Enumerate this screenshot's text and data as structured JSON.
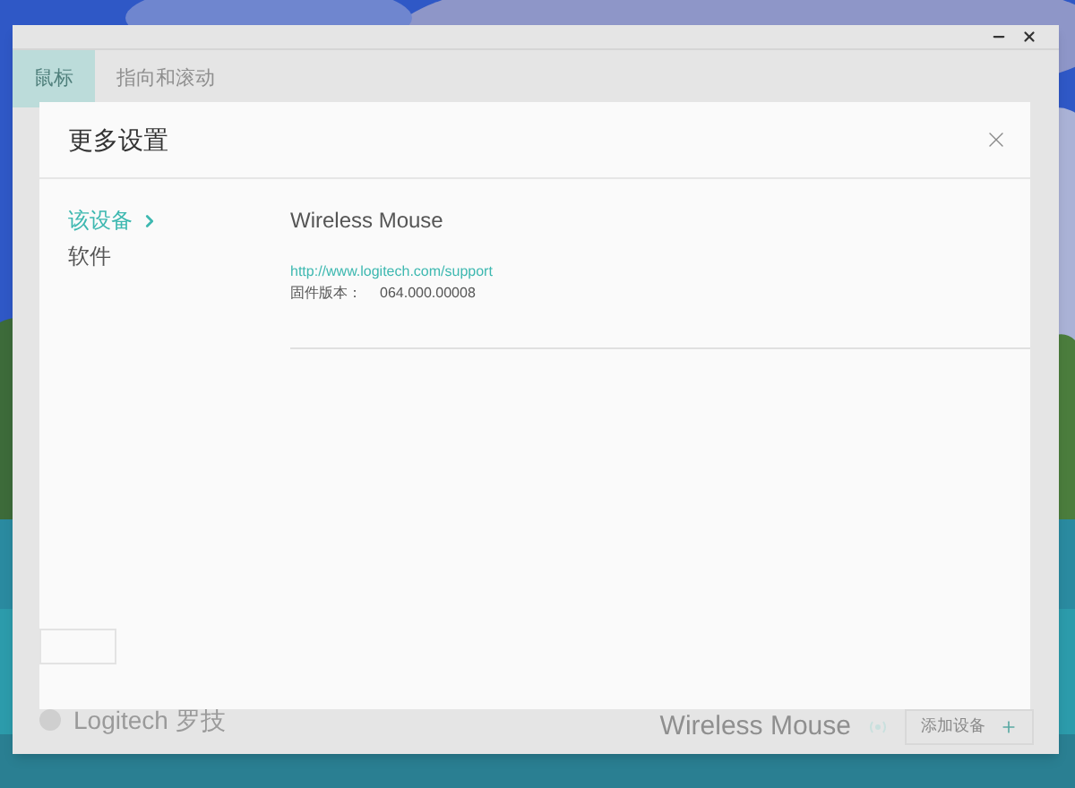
{
  "app": {
    "tabs": [
      {
        "label": "鼠标",
        "selected": true
      },
      {
        "label": "指向和滚动",
        "selected": false
      }
    ],
    "footer": {
      "brand": "Logitech 罗技",
      "device": "Wireless Mouse",
      "add_button": "添加设备"
    }
  },
  "dialog": {
    "title": "更多设置",
    "nav": [
      {
        "label": "该设备",
        "selected": true
      },
      {
        "label": "软件",
        "selected": false
      }
    ],
    "device_name": "Wireless Mouse",
    "support_link": "http://www.logitech.com/support",
    "firmware_label": "固件版本：",
    "firmware_value": "064.000.00008"
  }
}
